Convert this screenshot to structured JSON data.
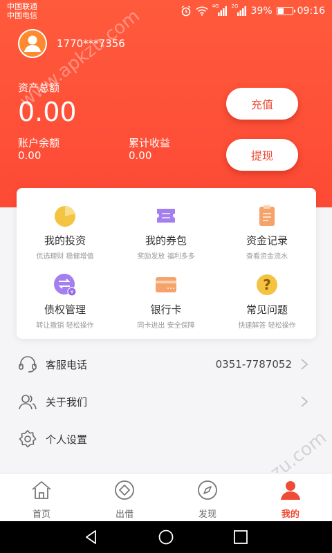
{
  "status_bar": {
    "carrier1": "中国联通",
    "carrier2": "中国电信",
    "net1": "4G",
    "net2": "2G",
    "battery": "39%",
    "battery_level": 0.39,
    "time": "09:16"
  },
  "profile": {
    "phone": "1770***7356"
  },
  "assets": {
    "total_label": "资产总额",
    "total_value": "0.00",
    "balance_label": "账户余额",
    "balance_value": "0.00",
    "earnings_label": "累计收益",
    "earnings_value": "0.00",
    "recharge_label": "充值",
    "withdraw_label": "提现"
  },
  "grid": [
    {
      "title": "我的投资",
      "sub": "优选理财 稳健增值",
      "icon": "pie-chart-icon",
      "color": "#f5c342"
    },
    {
      "title": "我的券包",
      "sub": "奖励发放 福利多多",
      "icon": "ticket-icon",
      "color": "#a47ff0"
    },
    {
      "title": "资金记录",
      "sub": "查看资金流水",
      "icon": "clipboard-icon",
      "color": "#f5a26b"
    },
    {
      "title": "债权管理",
      "sub": "转让撤销 轻松操作",
      "icon": "transfer-icon",
      "color": "#a47ff0"
    },
    {
      "title": "银行卡",
      "sub": "同卡进出 安全保障",
      "icon": "bank-card-icon",
      "color": "#f5a26b"
    },
    {
      "title": "常见问题",
      "sub": "快速解答 轻松操作",
      "icon": "question-icon",
      "color": "#f5c342"
    }
  ],
  "list": {
    "service_label": "客服电话",
    "service_phone": "0351-7787052",
    "about_label": "关于我们",
    "settings_label": "个人设置"
  },
  "tabs": {
    "home": "首页",
    "lend": "出借",
    "discover": "发现",
    "mine": "我的"
  },
  "watermark": "www.apkzu.com",
  "colors": {
    "accent": "#ef4b36",
    "header": "#fd4f37"
  }
}
